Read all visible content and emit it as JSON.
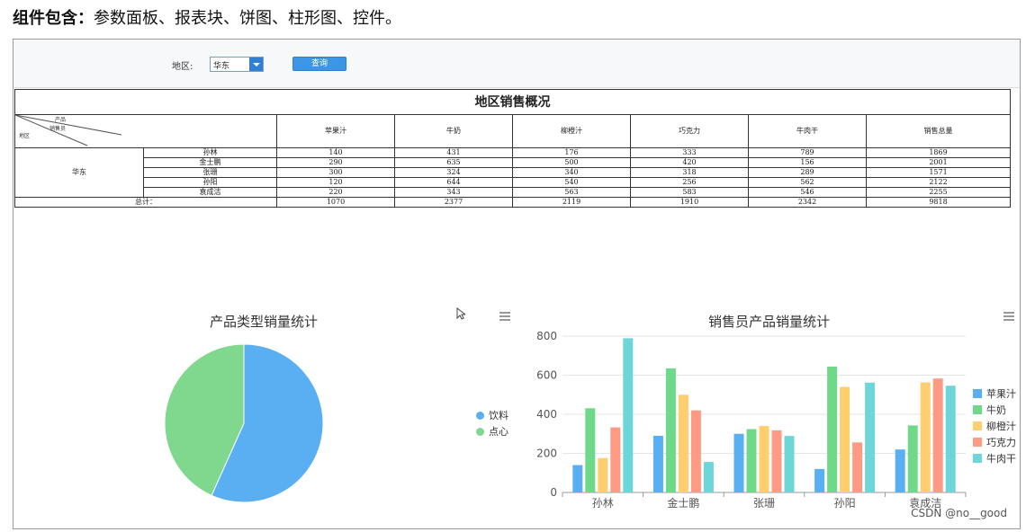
{
  "heading": {
    "label": "组件包含：",
    "text": "参数面板、报表块、饼图、柱形图、控件。"
  },
  "param": {
    "label": "地区:",
    "value": "华东",
    "query": "查询"
  },
  "report": {
    "title": "地区销售概况",
    "corner_top": "产品",
    "corner_mid": "销售员",
    "corner_bottom": "地区",
    "columns": [
      "苹果汁",
      "牛奶",
      "柳橙汁",
      "巧克力",
      "牛肉干",
      "销售总量"
    ],
    "region": "华东",
    "rows": [
      {
        "name": "孙林",
        "values": [
          "140",
          "431",
          "176",
          "333",
          "789",
          "1869"
        ]
      },
      {
        "name": "金士鹏",
        "values": [
          "290",
          "635",
          "500",
          "420",
          "156",
          "2001"
        ]
      },
      {
        "name": "张珊",
        "values": [
          "300",
          "324",
          "340",
          "318",
          "289",
          "1571"
        ]
      },
      {
        "name": "孙阳",
        "values": [
          "120",
          "644",
          "540",
          "256",
          "562",
          "2122"
        ]
      },
      {
        "name": "袁成洁",
        "values": [
          "220",
          "343",
          "563",
          "583",
          "546",
          "2255"
        ]
      }
    ],
    "total_label": "总计：",
    "totals": [
      "1070",
      "2377",
      "2119",
      "1910",
      "2342",
      "9818"
    ]
  },
  "colors": {
    "drinks": "#5aaef2",
    "snacks": "#7fd88e",
    "series": [
      "#5aaef2",
      "#6fd98a",
      "#ffce6e",
      "#ff9a84",
      "#6dd6d9"
    ]
  },
  "chart_data": [
    {
      "type": "pie",
      "title": "产品类型销量统计",
      "slices": [
        {
          "name": "饮料",
          "value": 5566
        },
        {
          "name": "点心",
          "value": 4252
        }
      ]
    },
    {
      "type": "bar",
      "title": "销售员产品销量统计",
      "categories": [
        "孙林",
        "金士鹏",
        "张珊",
        "孙阳",
        "袁成洁"
      ],
      "ylim": [
        0,
        800
      ],
      "yticks": [
        0,
        200,
        400,
        600,
        800
      ],
      "series": [
        {
          "name": "苹果汁",
          "values": [
            140,
            290,
            300,
            120,
            220
          ]
        },
        {
          "name": "牛奶",
          "values": [
            431,
            635,
            324,
            644,
            343
          ]
        },
        {
          "name": "柳橙汁",
          "values": [
            176,
            500,
            340,
            540,
            563
          ]
        },
        {
          "name": "巧克力",
          "values": [
            333,
            420,
            318,
            256,
            583
          ]
        },
        {
          "name": "牛肉干",
          "values": [
            789,
            156,
            289,
            562,
            546
          ]
        }
      ]
    }
  ],
  "watermark": "CSDN @no__good"
}
